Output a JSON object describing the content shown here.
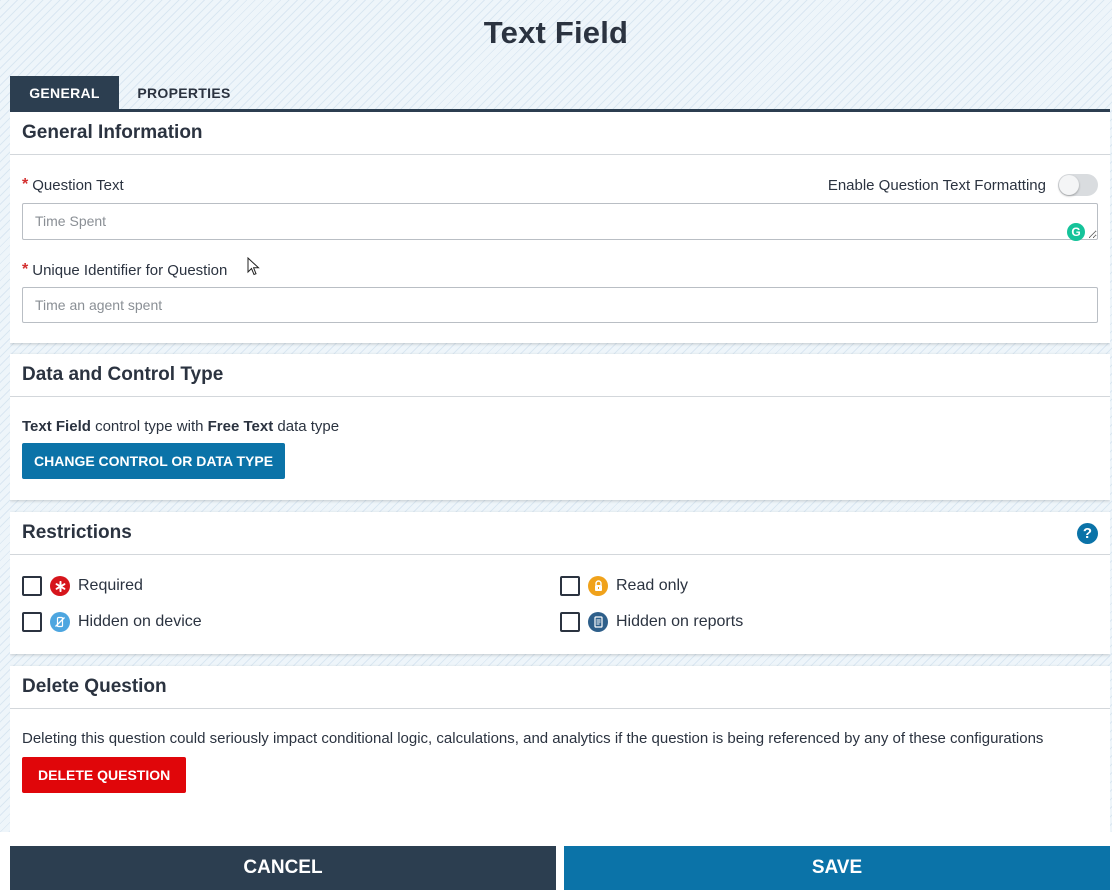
{
  "page": {
    "title": "Text Field"
  },
  "tabs": [
    {
      "label": "GENERAL",
      "active": true
    },
    {
      "label": "PROPERTIES",
      "active": false
    }
  ],
  "general_info": {
    "heading": "General Information",
    "question_text_label": "Question Text",
    "formatting_toggle_label": "Enable Question Text Formatting",
    "formatting_enabled": false,
    "question_text_placeholder": "Time Spent",
    "unique_id_label": "Unique Identifier for Question",
    "unique_id_placeholder": "Time an agent spent",
    "required_marker": "*"
  },
  "data_control": {
    "heading": "Data and Control Type",
    "control_type": "Text Field",
    "text_between": " control type with ",
    "data_type": "Free Text",
    "text_after": " data type",
    "change_button": "CHANGE CONTROL OR DATA TYPE"
  },
  "restrictions": {
    "heading": "Restrictions",
    "help_icon": "?",
    "items": [
      {
        "label": "Required",
        "icon": "asterisk-icon",
        "color": "#d6151c",
        "checked": false
      },
      {
        "label": "Read only",
        "icon": "lock-icon",
        "color": "#f0a21b",
        "checked": false
      },
      {
        "label": "Hidden on device",
        "icon": "no-device-icon",
        "color": "#4da6e0",
        "checked": false
      },
      {
        "label": "Hidden on reports",
        "icon": "report-icon",
        "color": "#2e5f8a",
        "checked": false
      }
    ]
  },
  "delete": {
    "heading": "Delete Question",
    "warning": "Deleting this question could seriously impact conditional logic, calculations, and analytics if the question is being referenced by any of these configurations",
    "button": "DELETE QUESTION"
  },
  "footer": {
    "cancel": "CANCEL",
    "save": "SAVE"
  },
  "colors": {
    "primary": "#0b73a8",
    "dark": "#2c3e50",
    "danger": "#e0060a"
  }
}
